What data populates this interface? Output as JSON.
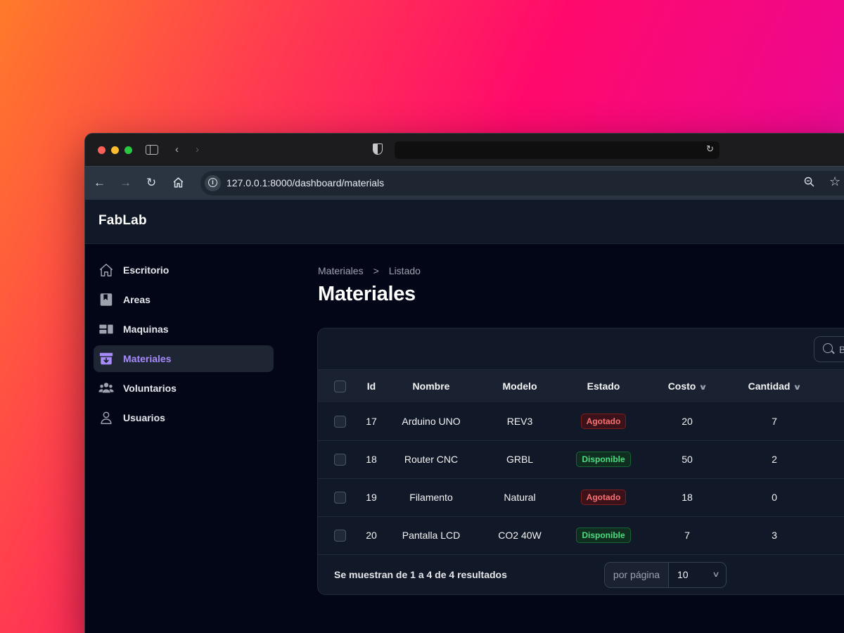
{
  "browser": {
    "url": "127.0.0.1:8000/dashboard/materials"
  },
  "app": {
    "brand": "FabLab"
  },
  "sidebar": {
    "items": [
      {
        "label": "Escritorio",
        "icon": "home-icon",
        "active": false
      },
      {
        "label": "Areas",
        "icon": "bookmark-icon",
        "active": false
      },
      {
        "label": "Maquinas",
        "icon": "machines-icon",
        "active": false
      },
      {
        "label": "Materiales",
        "icon": "archive-box-icon",
        "active": true
      },
      {
        "label": "Voluntarios",
        "icon": "users-icon",
        "active": false
      },
      {
        "label": "Usuarios",
        "icon": "user-icon",
        "active": false
      }
    ]
  },
  "breadcrumb": {
    "parent": "Materiales",
    "separator": ">",
    "current": "Listado"
  },
  "page": {
    "title": "Materiales"
  },
  "search": {
    "placeholder": "B"
  },
  "table": {
    "columns": [
      "Id",
      "Nombre",
      "Modelo",
      "Estado",
      "Costo",
      "Cantidad"
    ],
    "rows": [
      {
        "id": "17",
        "nombre": "Arduino UNO",
        "modelo": "REV3",
        "estado": "Agotado",
        "costo": "20",
        "cantidad": "7"
      },
      {
        "id": "18",
        "nombre": "Router CNC",
        "modelo": "GRBL",
        "estado": "Disponible",
        "costo": "50",
        "cantidad": "2"
      },
      {
        "id": "19",
        "nombre": "Filamento",
        "modelo": "Natural",
        "estado": "Agotado",
        "costo": "18",
        "cantidad": "0"
      },
      {
        "id": "20",
        "nombre": "Pantalla LCD",
        "modelo": "CO2 40W",
        "estado": "Disponible",
        "costo": "7",
        "cantidad": "3"
      }
    ]
  },
  "footer": {
    "results_text": "Se muestran de 1 a 4 de 4 resultados",
    "per_page_label": "por página",
    "per_page_value": "10"
  },
  "colors": {
    "accent": "#a78bfa",
    "agotado": "#f87171",
    "disponible": "#4ade80"
  }
}
